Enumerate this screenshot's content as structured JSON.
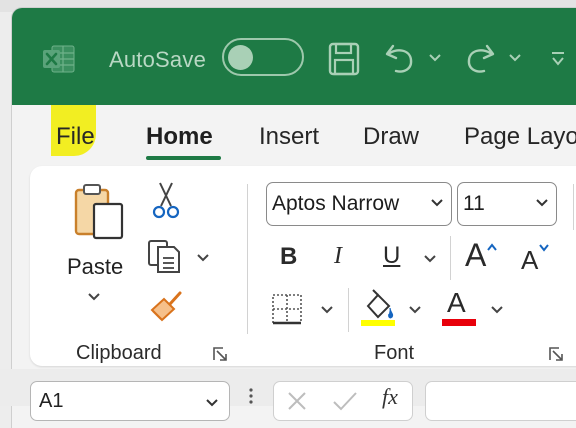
{
  "titlebar": {
    "autosave_label": "AutoSave",
    "autosave_state": "off",
    "app_icon": "excel-icon",
    "icons": [
      "save-icon",
      "undo-icon",
      "redo-icon",
      "customize-qat-icon"
    ]
  },
  "tabs": [
    {
      "label": "File"
    },
    {
      "label": "Home",
      "selected": true
    },
    {
      "label": "Insert"
    },
    {
      "label": "Draw"
    },
    {
      "label": "Page Layo"
    }
  ],
  "clipboard": {
    "paste_label": "Paste",
    "group_label": "Clipboard",
    "icons": [
      "paste-icon",
      "cut-icon",
      "copy-icon",
      "format-painter-icon"
    ]
  },
  "font": {
    "font_name": "Aptos Narrow",
    "font_size": "11",
    "bold": "B",
    "italic": "I",
    "underline": "U",
    "grow": "A",
    "shrink": "A",
    "font_color": "A",
    "group_label": "Font",
    "highlight_color": "#ffff00",
    "font_color_value": "#e8000b"
  },
  "formula_bar": {
    "name_box": "A1",
    "fx": "fx"
  },
  "colors": {
    "titlebar": "#1e7a45",
    "accent": "#1e7a45",
    "file_highlight": "#f2ee22"
  }
}
